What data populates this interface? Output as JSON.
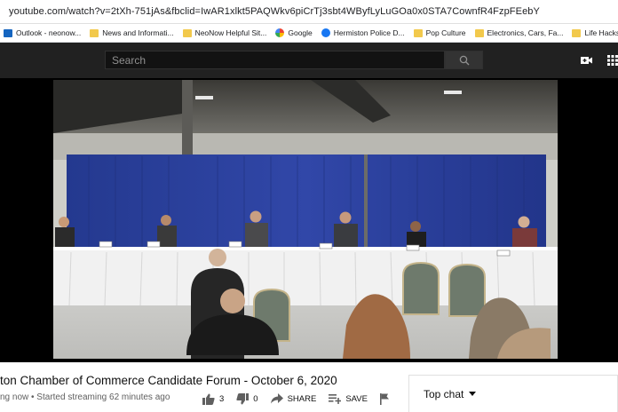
{
  "browser": {
    "url": "youtube.com/watch?v=2tXh-751jAs&fbclid=IwAR1xlkt5PAQWkv6piCrTj3sbt4WByfLyLuGOa0x0STA7CownfR4FzpFEebY",
    "bookmarks": [
      {
        "label": "Outlook - neonow...",
        "icon": "outlook-icon"
      },
      {
        "label": "News and Informati...",
        "icon": "folder-icon"
      },
      {
        "label": "NeoNow Helpful Sit...",
        "icon": "folder-icon"
      },
      {
        "label": "Google",
        "icon": "google-icon"
      },
      {
        "label": "Hermiston Police D...",
        "icon": "facebook-icon"
      },
      {
        "label": "Pop Culture",
        "icon": "folder-icon"
      },
      {
        "label": "Electronics, Cars, Fa...",
        "icon": "folder-icon"
      },
      {
        "label": "Life Hacks",
        "icon": "folder-icon"
      }
    ]
  },
  "header": {
    "search_placeholder": "Search"
  },
  "video": {
    "title": "ton Chamber of Commerce Candidate Forum - October 6, 2020",
    "status": "ng now • Started streaming 62 minutes ago",
    "likes": "3",
    "dislikes": "0",
    "share_label": "SHARE",
    "save_label": "SAVE"
  },
  "chat": {
    "label": "Top chat"
  },
  "colors": {
    "header_bg": "#212121",
    "curtain_blue": "#2a3f9e",
    "tablecloth": "#f2f2f2"
  }
}
